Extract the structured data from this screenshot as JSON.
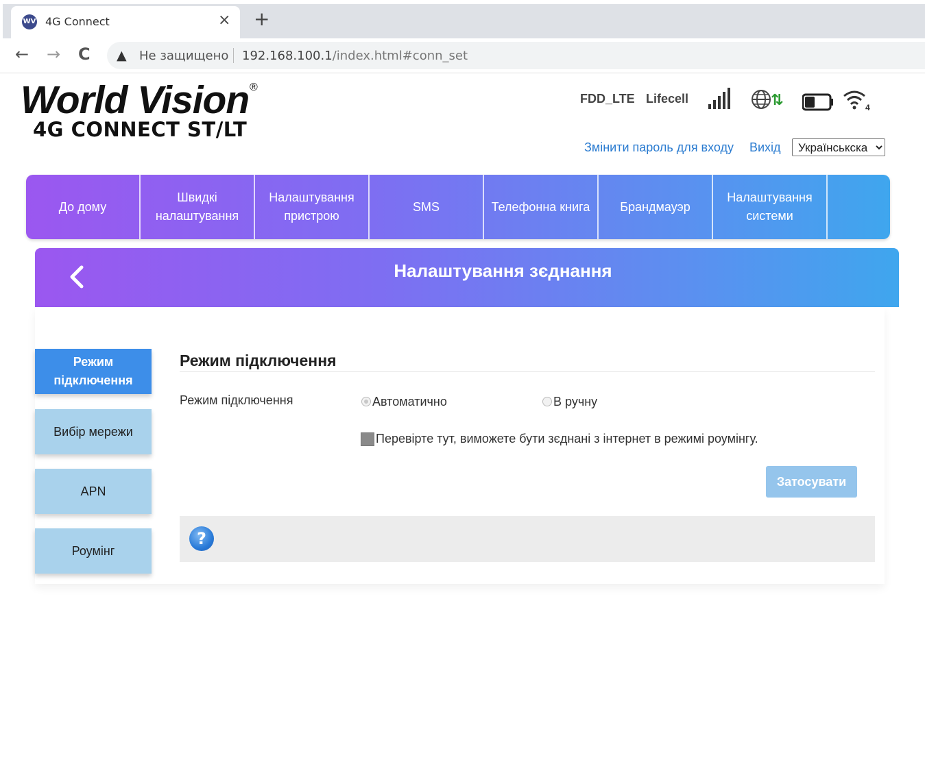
{
  "browser": {
    "tab_favicon_text": "WV",
    "tab_title": "4G Connect",
    "tab_close": "×",
    "new_tab": "+",
    "back": "←",
    "forward": "→",
    "reload": "C",
    "security_icon": "warning-triangle-icon",
    "not_secure": "Не защищено",
    "url_host": "192.168.100.1",
    "url_path": "/index.html#conn_set"
  },
  "header": {
    "logo_main": "World Vision",
    "logo_reg": "®",
    "logo_sub": "4G CONNECT ST/LT",
    "network_type": "FDD_LTE",
    "operator": "Lifecell",
    "wifi_clients": "4",
    "change_password": "Змінити пароль для входу",
    "logout": "Вихід",
    "language": "Українськска",
    "language_options": [
      "Українськска"
    ]
  },
  "nav": {
    "items": [
      {
        "label": "До дому"
      },
      {
        "label": "Швидкі налаштування"
      },
      {
        "label": "Налаштування пристрою"
      },
      {
        "label": "SMS"
      },
      {
        "label": "Телефонна книга"
      },
      {
        "label": "Брандмауэр"
      },
      {
        "label": "Налаштування системи"
      }
    ]
  },
  "page": {
    "title": "Налаштування зєднання"
  },
  "sidebar": {
    "items": [
      {
        "label": "Режим підключення",
        "active": true
      },
      {
        "label": "Вибір мережи",
        "active": false
      },
      {
        "label": "APN",
        "active": false
      },
      {
        "label": "Роумінг",
        "active": false
      }
    ]
  },
  "form": {
    "section_title": "Режим підключення",
    "mode_label": "Режим підключення",
    "option_auto": "Автоматично",
    "option_manual": "В ручну",
    "selected_mode": "Автоматично",
    "roaming_checkbox": "Перевірте тут, виможете бути зєднані з інтернет в режимі роумінгу.",
    "roaming_checked": false,
    "apply_button": "Затосувати",
    "help_icon_text": "?"
  },
  "colors": {
    "nav_gradient_start": "#9b57f0",
    "nav_gradient_end": "#3fa6ee",
    "link": "#2a7bd0",
    "sidebar_active": "#3d8ee9",
    "sidebar_inactive": "#a9d2ec",
    "apply_button": "#95c5ec"
  }
}
